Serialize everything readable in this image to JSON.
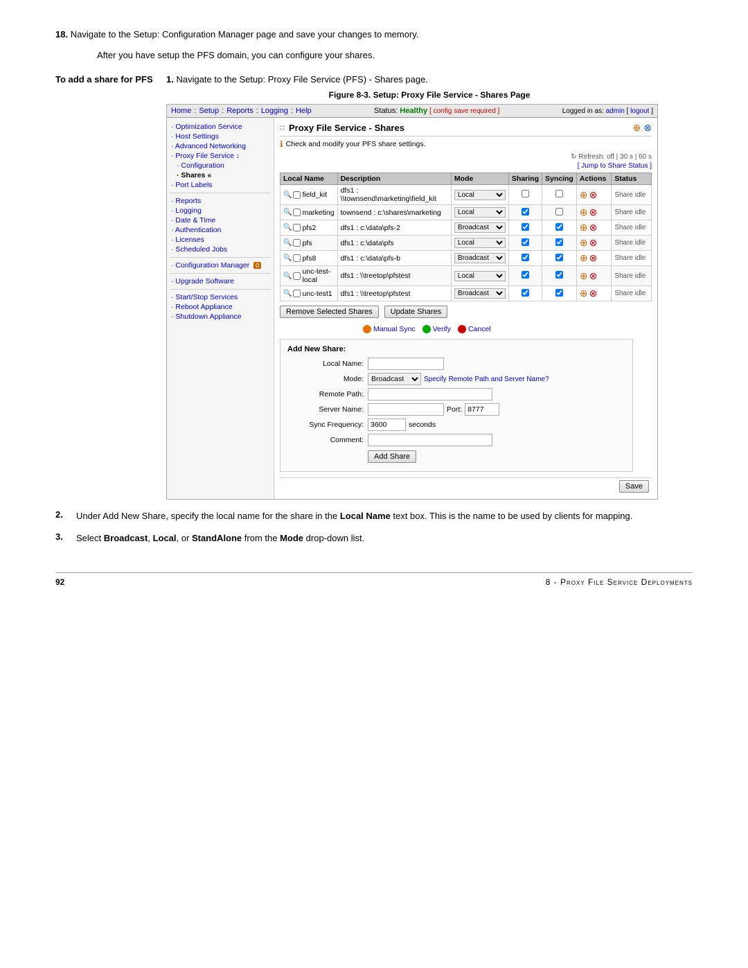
{
  "page": {
    "number": "92",
    "chapter": "8 - Proxy File Service Deployments"
  },
  "intro": {
    "step18": "Navigate to the Setup: Configuration Manager page and save your changes to memory.",
    "after_text": "After you have setup the PFS domain, you can configure your shares."
  },
  "to_add_label": "To add a share for PFS",
  "step1_text": "Navigate to the Setup: Proxy File Service (PFS) - Shares page.",
  "figure_caption": "Figure 8-3. Setup: Proxy File Service - Shares Page",
  "nav": {
    "home": "Home",
    "setup": "Setup",
    "reports": "Reports",
    "logging": "Logging",
    "help": "Help",
    "status_label": "Status:",
    "status_value": "Healthy",
    "config_note": "[ config save required ]",
    "logged_in": "Logged in as:",
    "admin": "admin",
    "logout": "logout"
  },
  "sidebar": {
    "items": [
      {
        "label": "· Optimization Service",
        "indent": 0
      },
      {
        "label": "· Host Settings",
        "indent": 0
      },
      {
        "label": "· Advanced Networking",
        "indent": 0
      },
      {
        "label": "· Proxy File Service ↓",
        "indent": 0,
        "active": false
      },
      {
        "label": "· Configuration",
        "indent": 1
      },
      {
        "label": "· Shares «",
        "indent": 1,
        "active": true
      },
      {
        "label": "· Port Labels",
        "indent": 0
      },
      {
        "label": "· Reports",
        "indent": 0
      },
      {
        "label": "· Logging",
        "indent": 0
      },
      {
        "label": "· Date & Time",
        "indent": 0
      },
      {
        "label": "· Authentication",
        "indent": 0
      },
      {
        "label": "· Licenses",
        "indent": 0
      },
      {
        "label": "· Scheduled Jobs",
        "indent": 0
      },
      {
        "label": "· Configuration Manager  ⓘ",
        "indent": 0
      },
      {
        "label": "· Upgrade Software",
        "indent": 0
      },
      {
        "label": "· Start/Stop Services",
        "indent": 0
      },
      {
        "label": "· Reboot Appliance",
        "indent": 0
      },
      {
        "label": "· Shutdown Appliance",
        "indent": 0
      }
    ]
  },
  "content": {
    "title": "Proxy File Service - Shares",
    "subtitle": "Check and modify your PFS share settings.",
    "refresh_label": "Refresh: off | 30 s | 60 s",
    "jump_label": "[ Jump to Share Status ]",
    "table": {
      "headers": [
        "Local Name",
        "Description",
        "Mode",
        "Sharing",
        "Syncing",
        "Actions",
        "Status"
      ],
      "rows": [
        {
          "name": "field_kit",
          "description": "dfs1 : \\\\townsend\\marketing\\field_kit",
          "mode": "Local",
          "sharing": false,
          "syncing": false,
          "status": "Share idle"
        },
        {
          "name": "marketing",
          "description": "townsend : c:\\shares\\marketing",
          "mode": "Local",
          "sharing": true,
          "syncing": false,
          "status": "Share idle"
        },
        {
          "name": "pfs2",
          "description": "dfs1 : c:\\data\\pfs-2",
          "mode": "Broadcast",
          "sharing": true,
          "syncing": true,
          "status": "Share idle"
        },
        {
          "name": "pfs",
          "description": "dfs1 : c:\\data\\pfs",
          "mode": "Local",
          "sharing": true,
          "syncing": true,
          "status": "Share idle"
        },
        {
          "name": "pfs8",
          "description": "dfs1 : c:\\data\\pfs-b",
          "mode": "Broadcast",
          "sharing": true,
          "syncing": true,
          "status": "Share idle"
        },
        {
          "name": "unc-test-local",
          "description": "dfs1 : \\\\treetop\\pfstest",
          "mode": "Local",
          "sharing": true,
          "syncing": true,
          "status": "Share idle"
        },
        {
          "name": "unc-test1",
          "description": "dfs1 : \\\\treetop\\pfstest",
          "mode": "Broadcast",
          "sharing": true,
          "syncing": true,
          "status": "Share idle"
        }
      ]
    },
    "buttons": {
      "remove_selected": "Remove Selected Shares",
      "update_shares": "Update Shares"
    },
    "sync_controls": {
      "manual_sync": "Manual Sync",
      "verify": "Verify",
      "cancel": "Cancel"
    },
    "add_share_form": {
      "title": "Add New Share:",
      "local_name_label": "Local Name:",
      "mode_label": "Mode:",
      "mode_default": "Broadcast",
      "mode_options": [
        "Broadcast",
        "Local",
        "StandAlone"
      ],
      "specify_text": "Specify Remote Path and Server Name?",
      "remote_path_label": "Remote Path:",
      "server_name_label": "Server Name:",
      "port_label": "Port:",
      "port_value": "8777",
      "sync_freq_label": "Sync Frequency:",
      "sync_freq_value": "3600",
      "seconds_label": "seconds",
      "comment_label": "Comment:",
      "add_share_btn": "Add Share"
    },
    "save_btn": "Save"
  },
  "bottom_steps": {
    "step2": "Under Add New Share, specify the local name for the share in the Local Name text box. This is the name to be used by clients for mapping.",
    "step2_bold": "Local Name",
    "step3_prefix": "Select ",
    "step3_broadcast": "Broadcast",
    "step3_local": "Local",
    "step3_standalone": "StandAlone",
    "step3_suffix": " from the ",
    "step3_mode": "Mode",
    "step3_end": " drop-down list."
  }
}
